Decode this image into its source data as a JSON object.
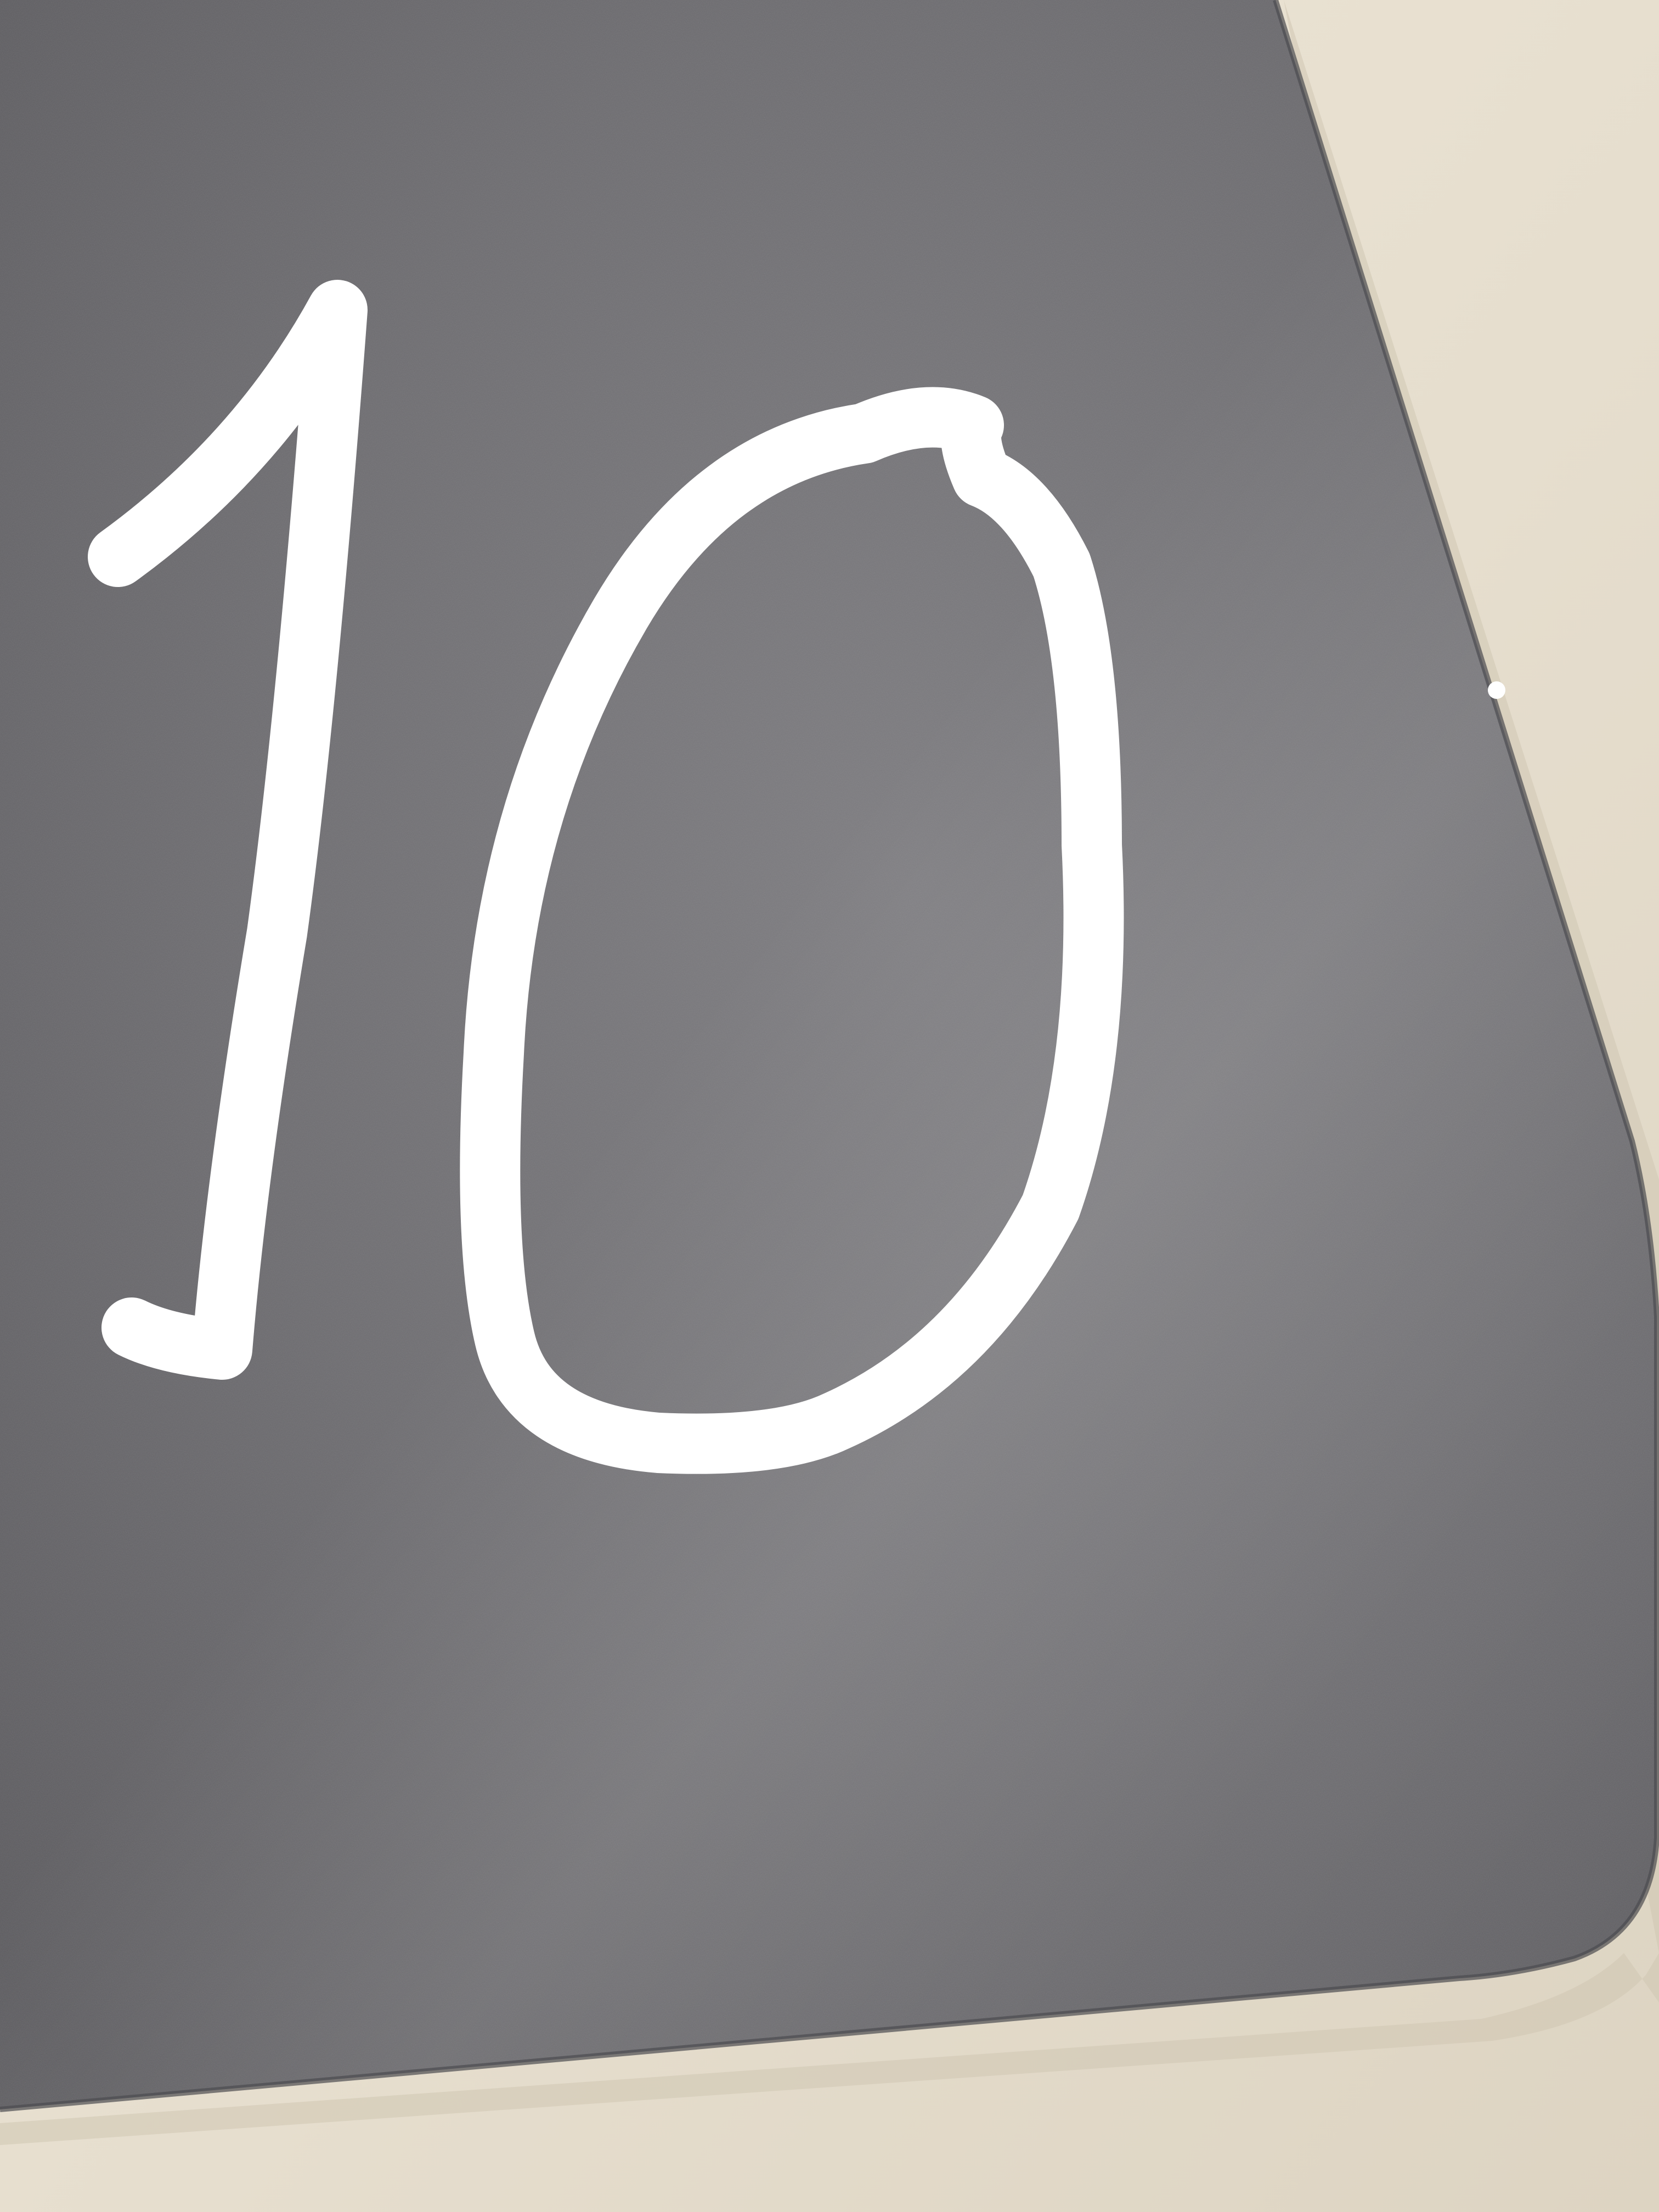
{
  "photo": {
    "handwritten_text": "10",
    "colors": {
      "desk_surface": "#e8e0cf",
      "desk_shadow": "#d8cfbd",
      "device_surface": "#6b6a6e",
      "device_highlight": "#8e8d91",
      "device_dark": "#58575b",
      "edge_line": "#4a4a4e",
      "marker_ink": "#ffffff"
    }
  }
}
